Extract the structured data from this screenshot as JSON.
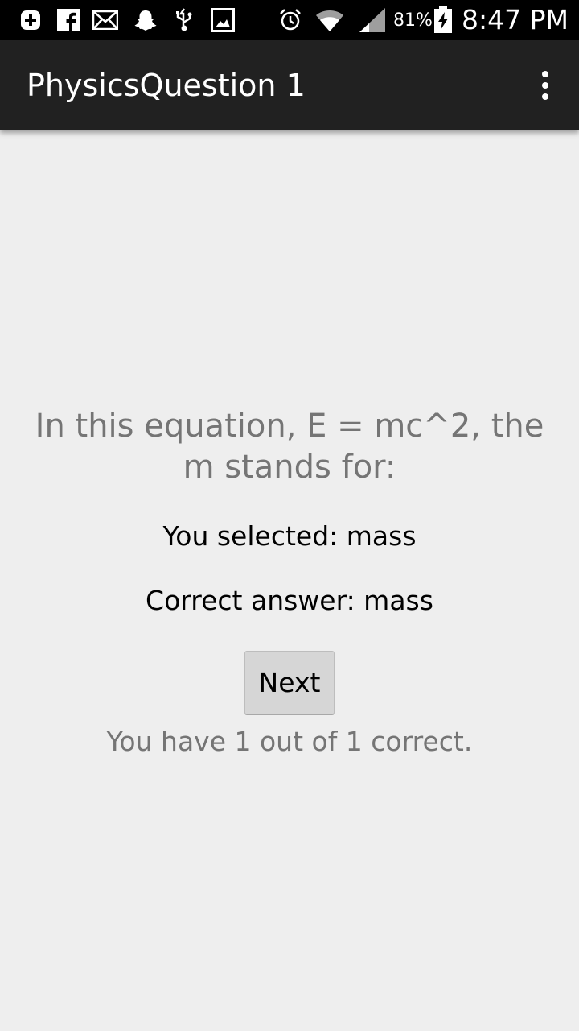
{
  "status_bar": {
    "battery_percent": "81%",
    "time": "8:47 PM",
    "notification_icons": [
      "plus-icon",
      "facebook-icon",
      "mail-icon",
      "snapchat-icon",
      "usb-icon",
      "gallery-icon"
    ],
    "system_icons": [
      "alarm-icon",
      "wifi-icon",
      "signal-icon",
      "battery-charging-icon"
    ]
  },
  "app_bar": {
    "title": "PhysicsQuestion 1",
    "overflow_icon": "more-vert-icon"
  },
  "quiz": {
    "question": "In this equation, E = mc^2, the m stands for:",
    "selected": "You selected: mass",
    "correct": "Correct answer: mass",
    "next_label": "Next",
    "score": "You have 1 out of 1 correct."
  },
  "colors": {
    "status_bar": "#000000",
    "app_bar": "#212121",
    "background": "#eeeeee",
    "secondary_text": "#757575",
    "button": "#d6d6d6"
  }
}
